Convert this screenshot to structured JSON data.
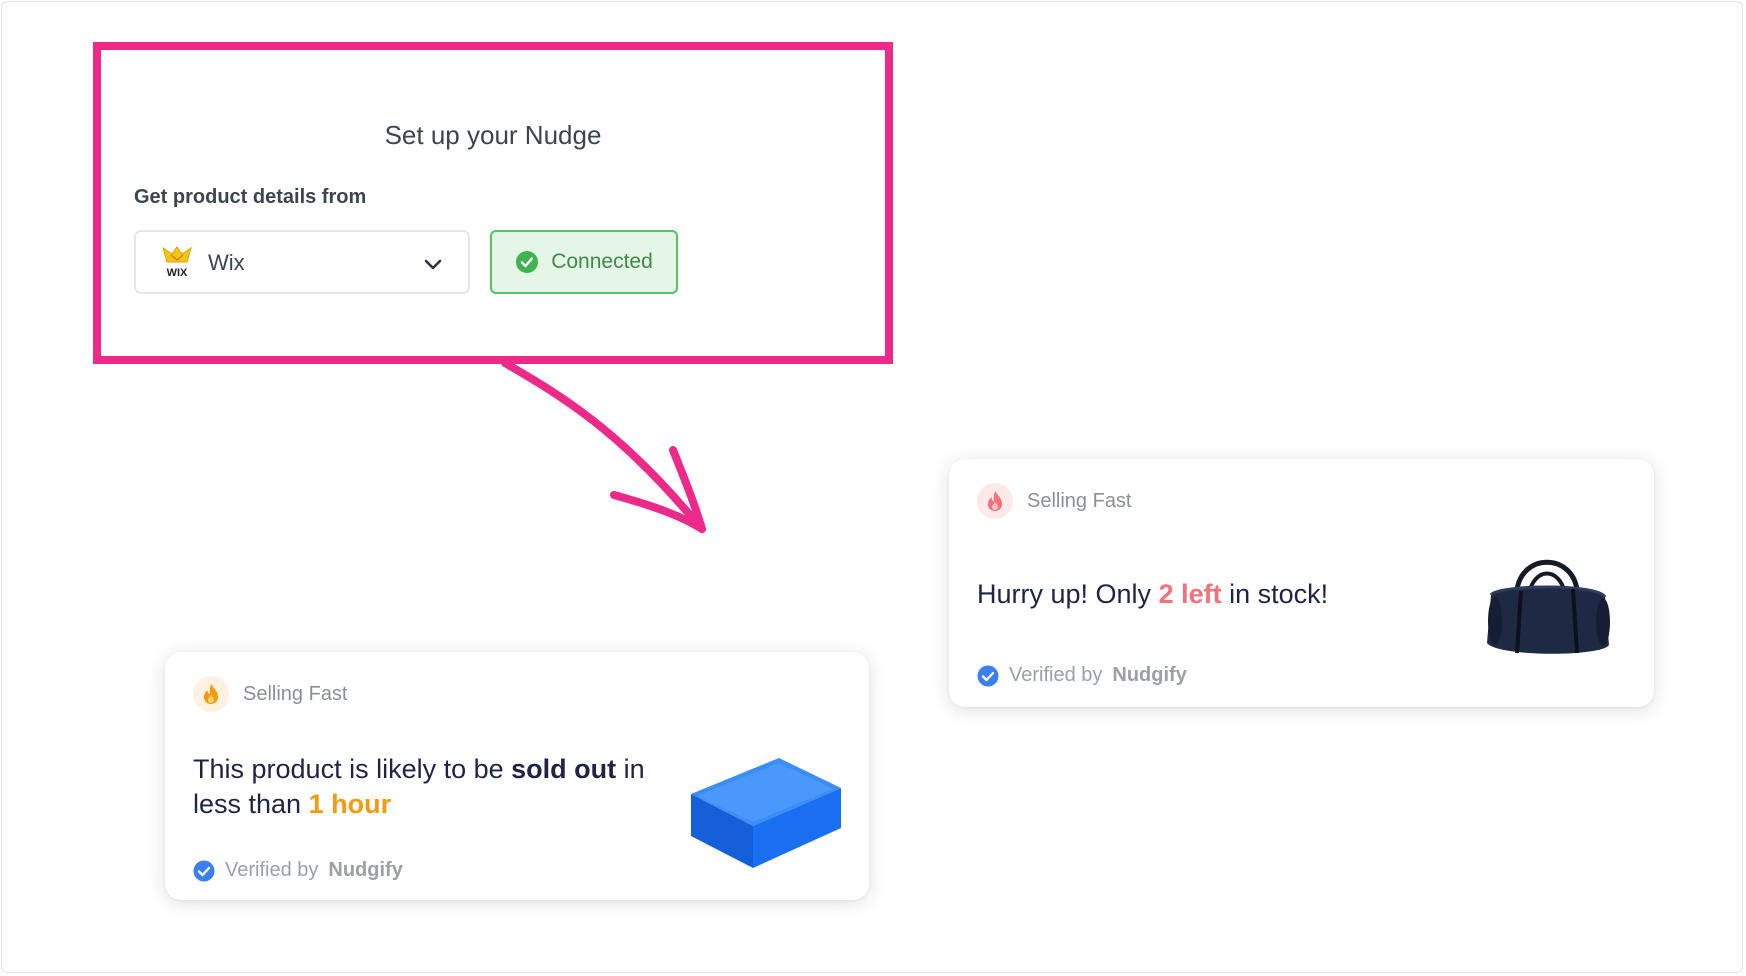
{
  "setup": {
    "title": "Set up your Nudge",
    "source_label": "Get product details from",
    "source_value": "Wix",
    "logo_text": "WIX",
    "status": "Connected"
  },
  "cards": [
    {
      "header": "Selling Fast",
      "message_parts": [
        "This product is likely to be ",
        "sold out",
        " in less than ",
        "1 hour"
      ],
      "verified_prefix": "Verified by",
      "verified_brand": "Nudgify",
      "product_icon": "blue-yoga-block"
    },
    {
      "header": "Selling Fast",
      "message_parts": [
        "Hurry up! Only ",
        "2 left",
        " in stock!"
      ],
      "verified_prefix": "Verified by",
      "verified_brand": "Nudgify",
      "product_icon": "duffel-bag"
    }
  ],
  "colors": {
    "highlight": "#ed2a8a",
    "connected": "#55c26a",
    "accent_orange": "#f59a0d",
    "accent_red": "#f2717a",
    "verify_blue": "#3b7ff0"
  }
}
